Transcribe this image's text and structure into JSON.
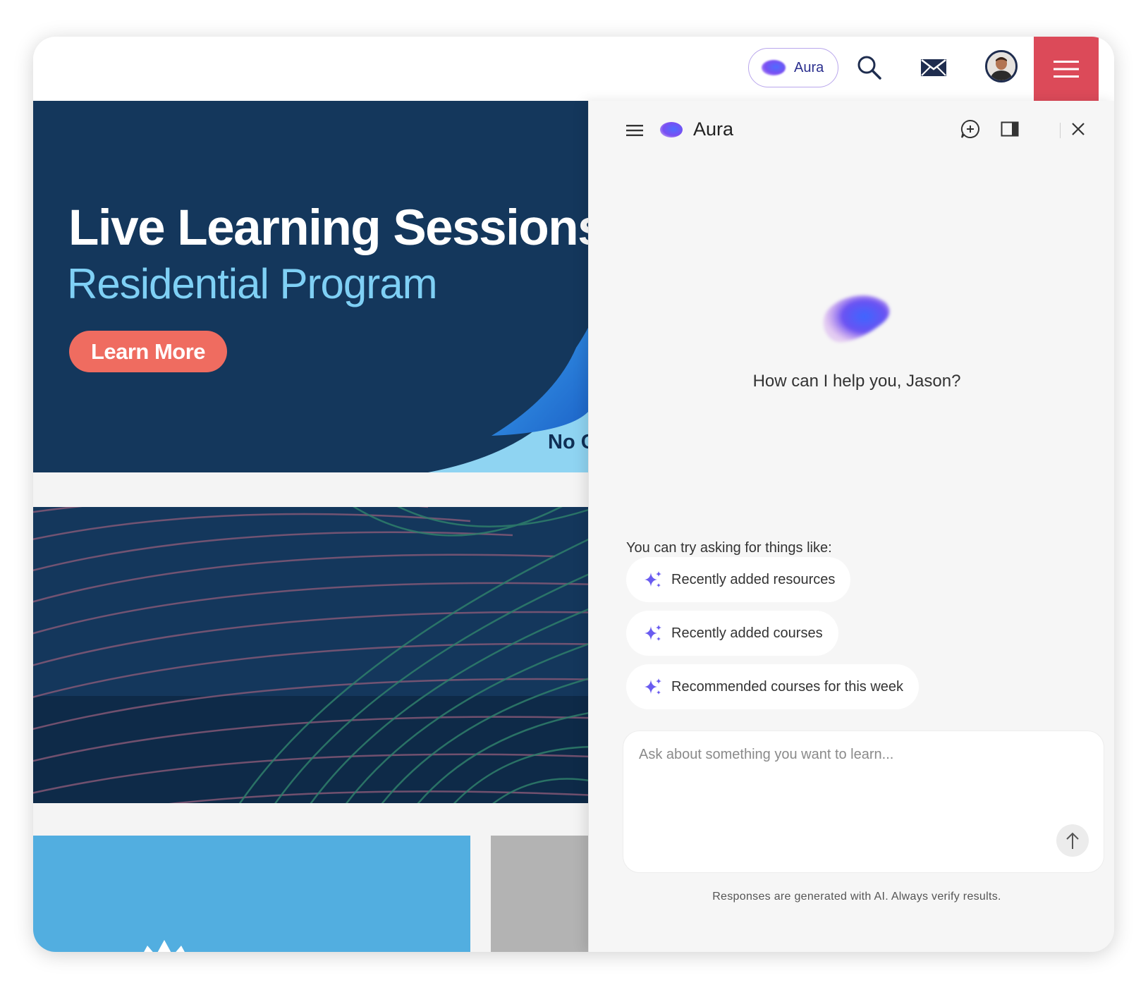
{
  "header": {
    "aura_button_label": "Aura",
    "brand_color": "#dc4a59"
  },
  "banner": {
    "title": "Live Learning Sessions",
    "subtitle": "Residential Program",
    "cta_label": "Learn More",
    "corner_text": "No C"
  },
  "aura_panel": {
    "title": "Aura",
    "greeting": "How can I help you, Jason?",
    "suggestions_label": "You can try asking for things like:",
    "suggestions": [
      {
        "label": "Recently added resources"
      },
      {
        "label": "Recently added courses"
      },
      {
        "label": "Recommended courses for this week"
      }
    ],
    "input_placeholder": "Ask about something you want to learn...",
    "disclaimer": "Responses are generated with AI. Always verify results.",
    "accent_color": "#6a5cf0"
  },
  "icons": [
    "aura-logo-icon",
    "search-icon",
    "mail-icon",
    "avatar",
    "hamburger-menu-icon",
    "new-chat-icon",
    "side-panel-icon",
    "close-icon",
    "sparkle-icon",
    "send-arrow-icon"
  ]
}
